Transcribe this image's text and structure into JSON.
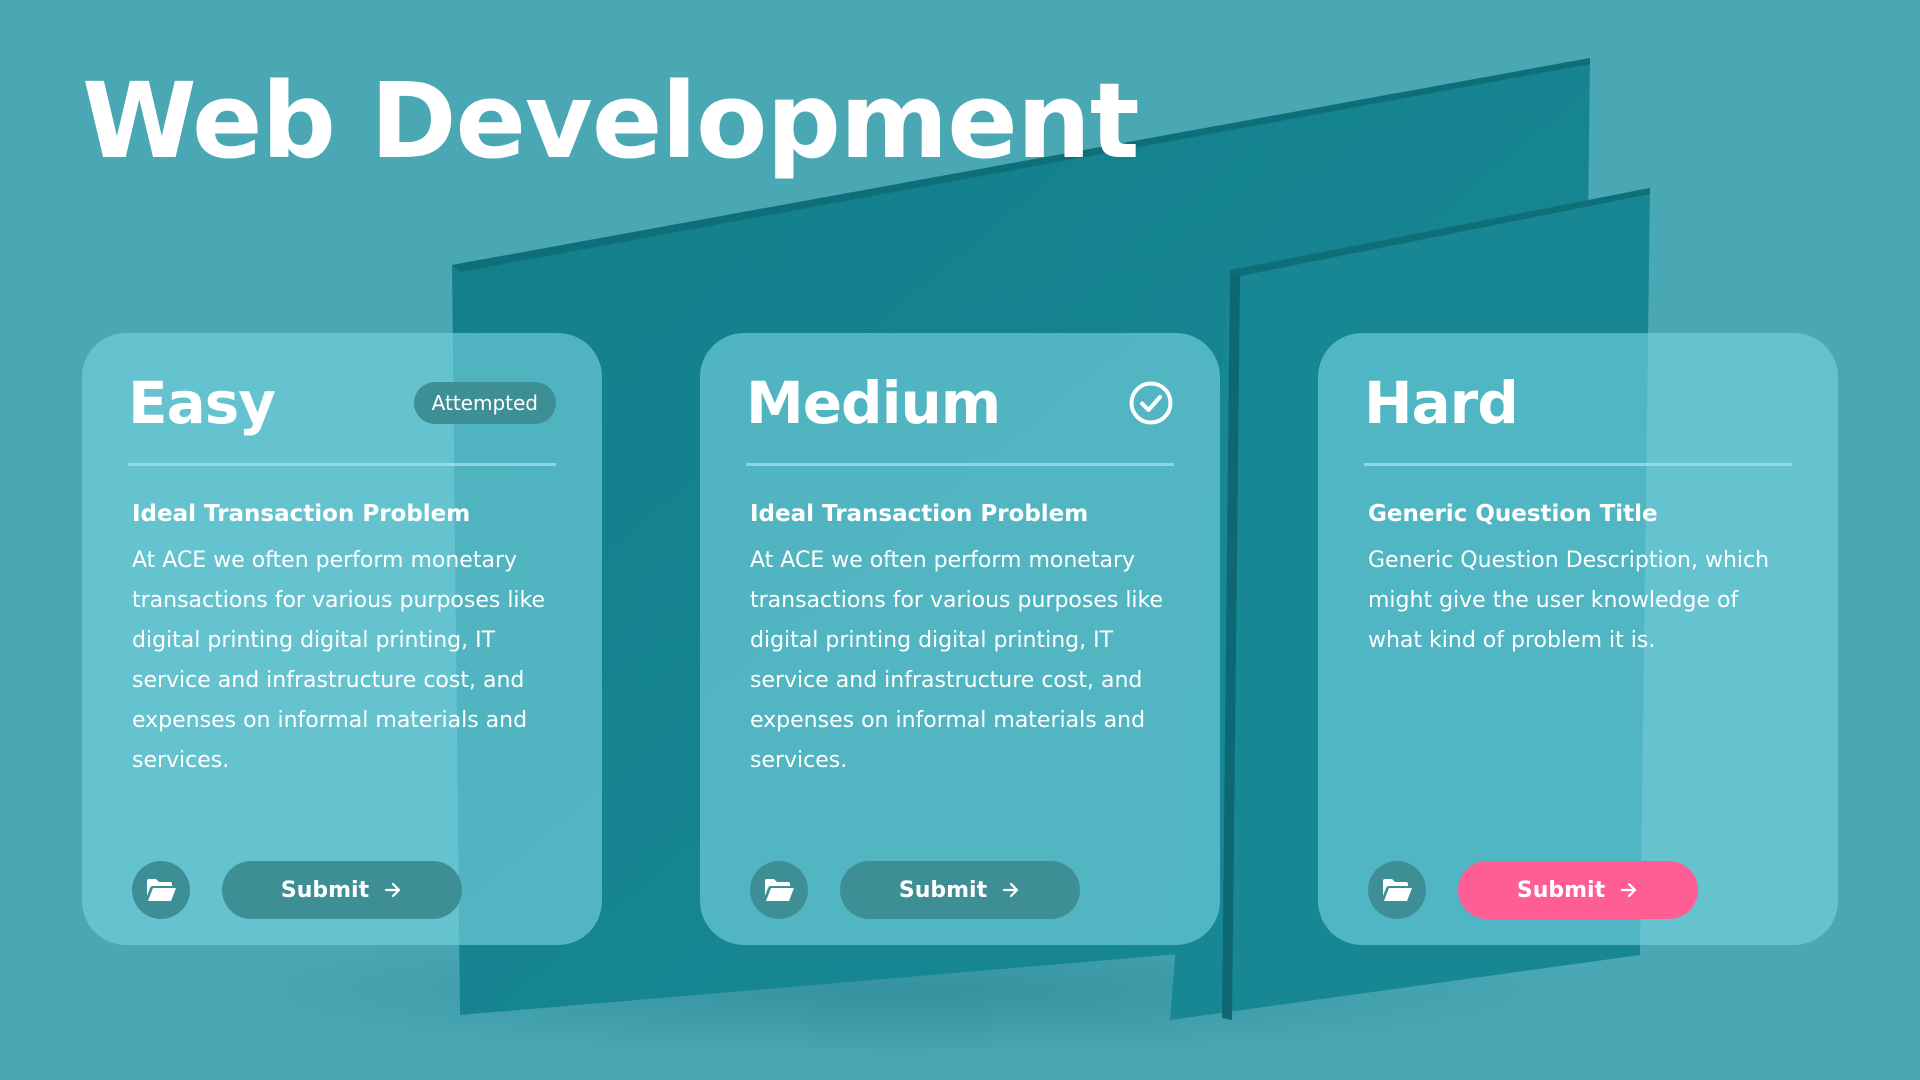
{
  "page": {
    "title": "Web Development"
  },
  "colors": {
    "background": "#4aa8b5",
    "panel": "#13848f",
    "card": "#76d4e0",
    "button_dark": "#3e8e96",
    "button_accent": "#fe5e94"
  },
  "cards": [
    {
      "difficulty": "Easy",
      "status": "Attempted",
      "status_icon": null,
      "question_title": "Ideal Transaction Problem",
      "question_description": "At ACE we often perform monetary transactions for various purposes like digital printing digital printing, IT service and infrastructure cost, and expenses on informal materials and services.",
      "folder_icon": "folder-open-icon",
      "submit_label": "Submit",
      "submit_icon": "arrow-right-icon",
      "submit_accent": false
    },
    {
      "difficulty": "Medium",
      "status": null,
      "status_icon": "check-circle-icon",
      "question_title": "Ideal Transaction Problem",
      "question_description": "At ACE we often perform monetary transactions for various purposes like digital printing digital printing, IT service and infrastructure cost, and expenses on informal materials and services.",
      "folder_icon": "folder-open-icon",
      "submit_label": "Submit",
      "submit_icon": "arrow-right-icon",
      "submit_accent": false
    },
    {
      "difficulty": "Hard",
      "status": null,
      "status_icon": null,
      "question_title": "Generic Question Title",
      "question_description": "Generic Question Description, which might give the user knowledge of what kind of problem it is.",
      "folder_icon": "folder-open-icon",
      "submit_label": "Submit",
      "submit_icon": "arrow-right-icon",
      "submit_accent": true
    }
  ]
}
